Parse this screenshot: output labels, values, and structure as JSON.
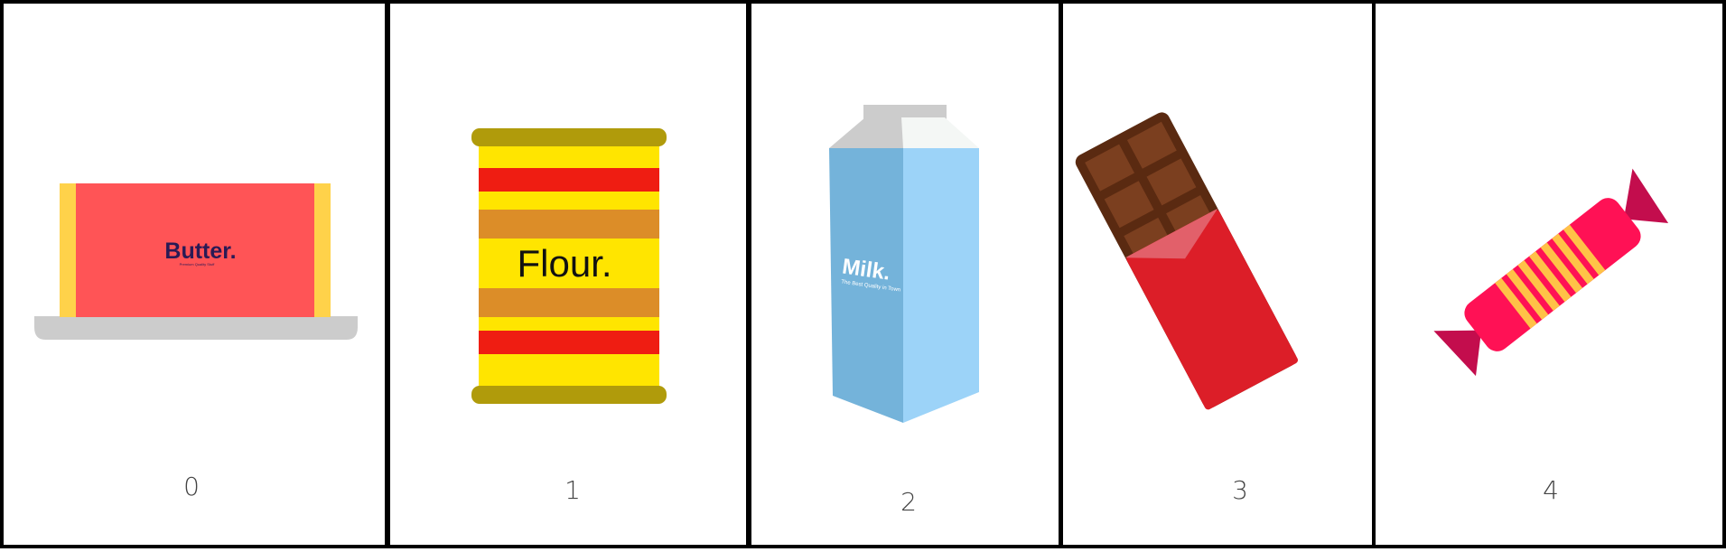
{
  "cards": [
    {
      "index": "0",
      "item": "butter",
      "label": "Butter.",
      "sublabel": "Premium Quality Stuff"
    },
    {
      "index": "1",
      "item": "flour",
      "label": "Flour."
    },
    {
      "index": "2",
      "item": "milk",
      "label": "Milk.",
      "sublabel": "The Best Quality in Town"
    },
    {
      "index": "3",
      "item": "chocolate"
    },
    {
      "index": "4",
      "item": "candy"
    }
  ],
  "colors": {
    "border": "#000000",
    "butter_wrapper": "#ff5456",
    "butter_ends": "#ffd24a",
    "plate": "#cccccc",
    "flour_yellow": "#ffe500",
    "flour_red": "#ef1d12",
    "flour_orange": "#dc8d28",
    "flour_lid": "#b09b0b",
    "milk_light": "#9cd3f8",
    "milk_dark": "#74b3da",
    "chocolate_brown": "#7b3f1f",
    "chocolate_wrapper": "#dc1e28",
    "candy_pink": "#ff1155",
    "candy_stripes": "#ffc247"
  }
}
